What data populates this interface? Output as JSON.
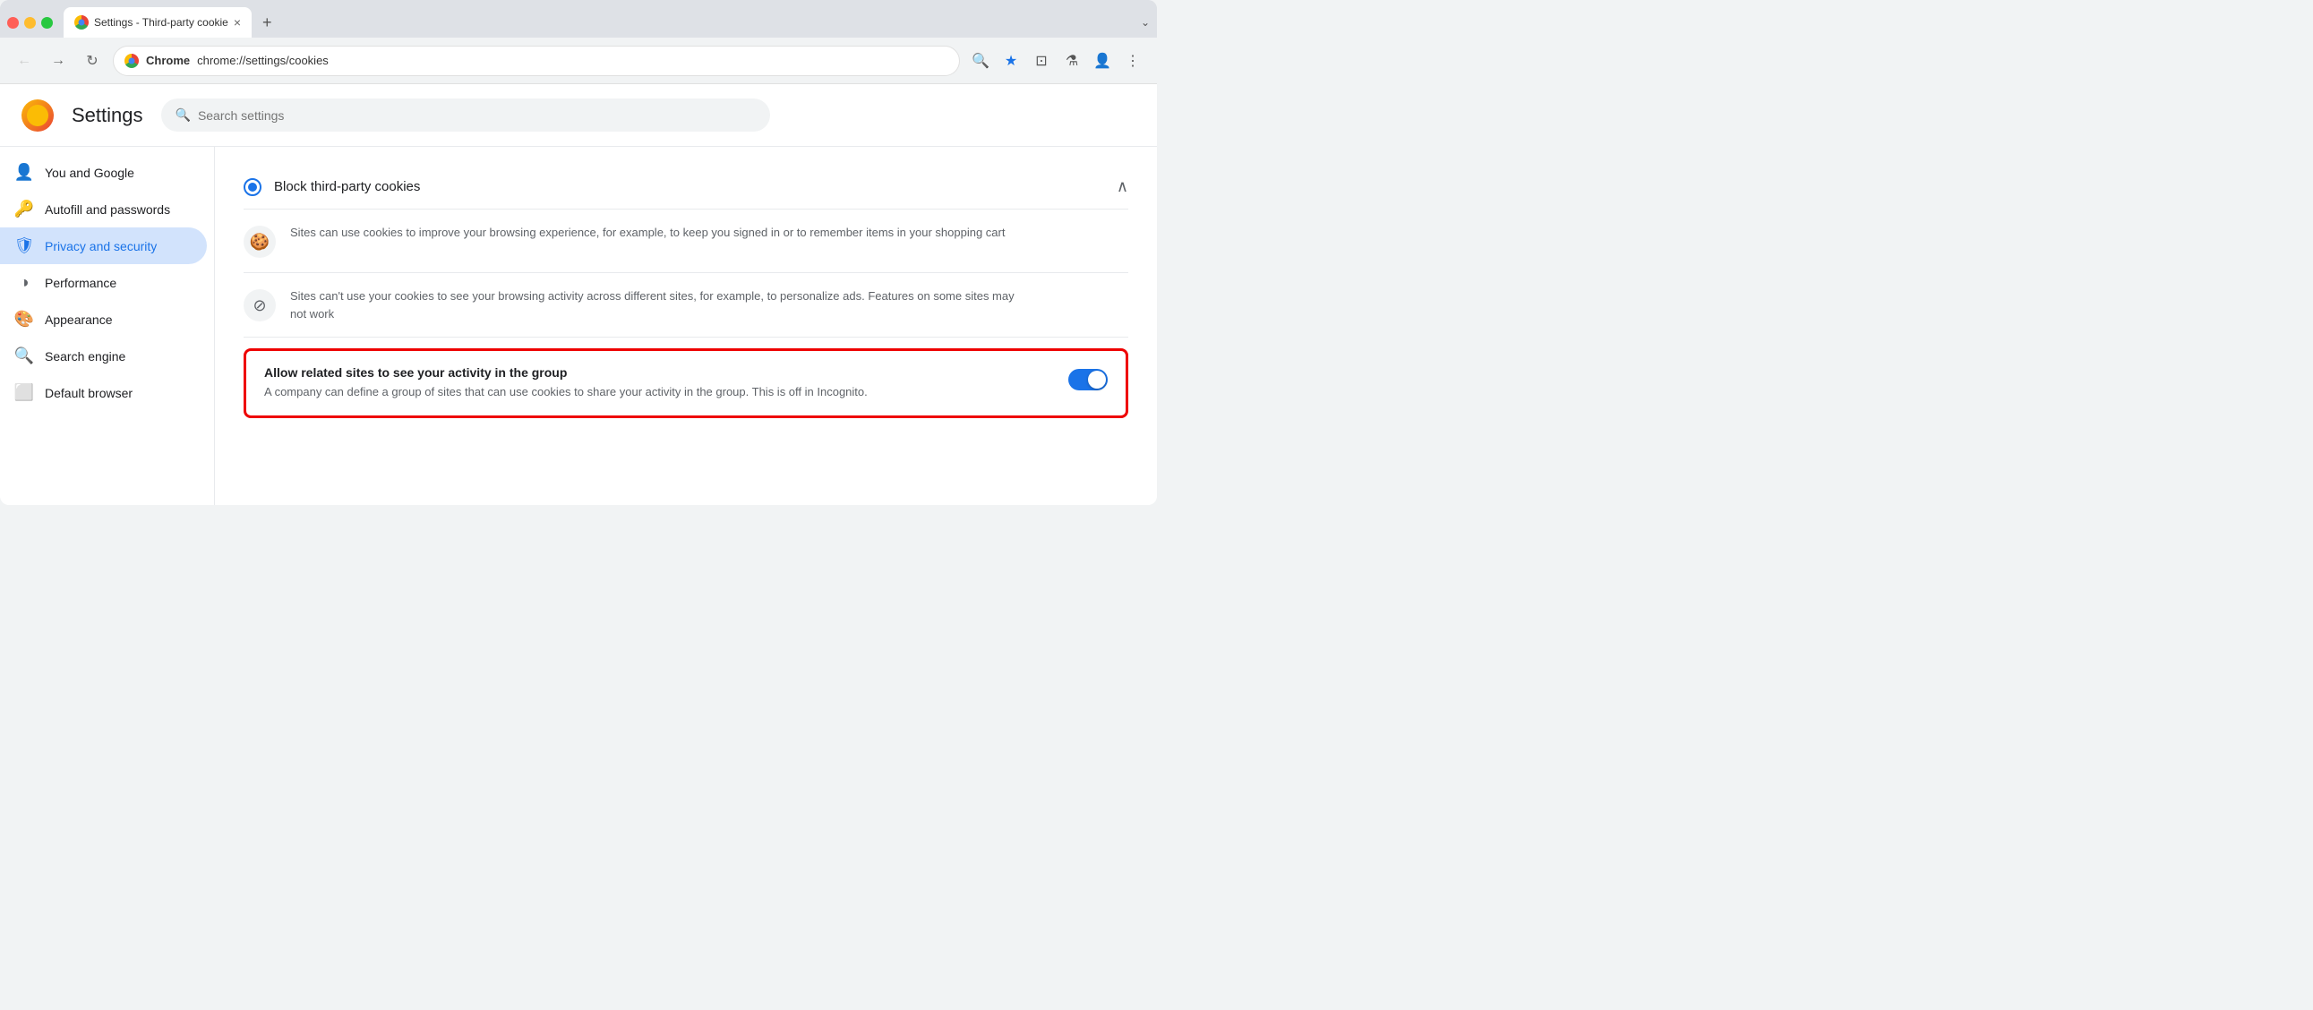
{
  "browser": {
    "tab_title": "Settings - Third-party cookie",
    "tab_close": "×",
    "new_tab": "+",
    "dropdown": "⌄"
  },
  "toolbar": {
    "back": "←",
    "forward": "→",
    "reload": "↻",
    "address_label": "Chrome",
    "address_url": "chrome://settings/cookies",
    "zoom_icon": "🔍",
    "bookmark_icon": "★",
    "extensions_icon": "⊡",
    "labs_icon": "⚗",
    "profile_icon": "👤",
    "menu_icon": "⋮"
  },
  "settings": {
    "logo_alt": "Chrome Settings",
    "title": "Settings",
    "search_placeholder": "Search settings"
  },
  "sidebar": {
    "items": [
      {
        "id": "you-and-google",
        "label": "You and Google",
        "icon": "👤",
        "active": false
      },
      {
        "id": "autofill-passwords",
        "label": "Autofill and passwords",
        "icon": "🔑",
        "active": false
      },
      {
        "id": "privacy-security",
        "label": "Privacy and security",
        "icon": "🛡",
        "active": true
      },
      {
        "id": "performance",
        "label": "Performance",
        "icon": "◑",
        "active": false
      },
      {
        "id": "appearance",
        "label": "Appearance",
        "icon": "🎨",
        "active": false
      },
      {
        "id": "search-engine",
        "label": "Search engine",
        "icon": "🔍",
        "active": false
      },
      {
        "id": "default-browser",
        "label": "Default browser",
        "icon": "⬜",
        "active": false
      }
    ]
  },
  "main": {
    "block_cookies_label": "Block third-party cookies",
    "info1_text": "Sites can use cookies to improve your browsing experience, for example, to keep you signed in or to remember items in your shopping cart",
    "info2_text": "Sites can't use your cookies to see your browsing activity across different sites, for example, to personalize ads. Features on some sites may not work",
    "highlighted_title": "Allow related sites to see your activity in the group",
    "highlighted_desc": "A company can define a group of sites that can use cookies to share your activity in the group. This is off in Incognito.",
    "toggle_on": true
  }
}
